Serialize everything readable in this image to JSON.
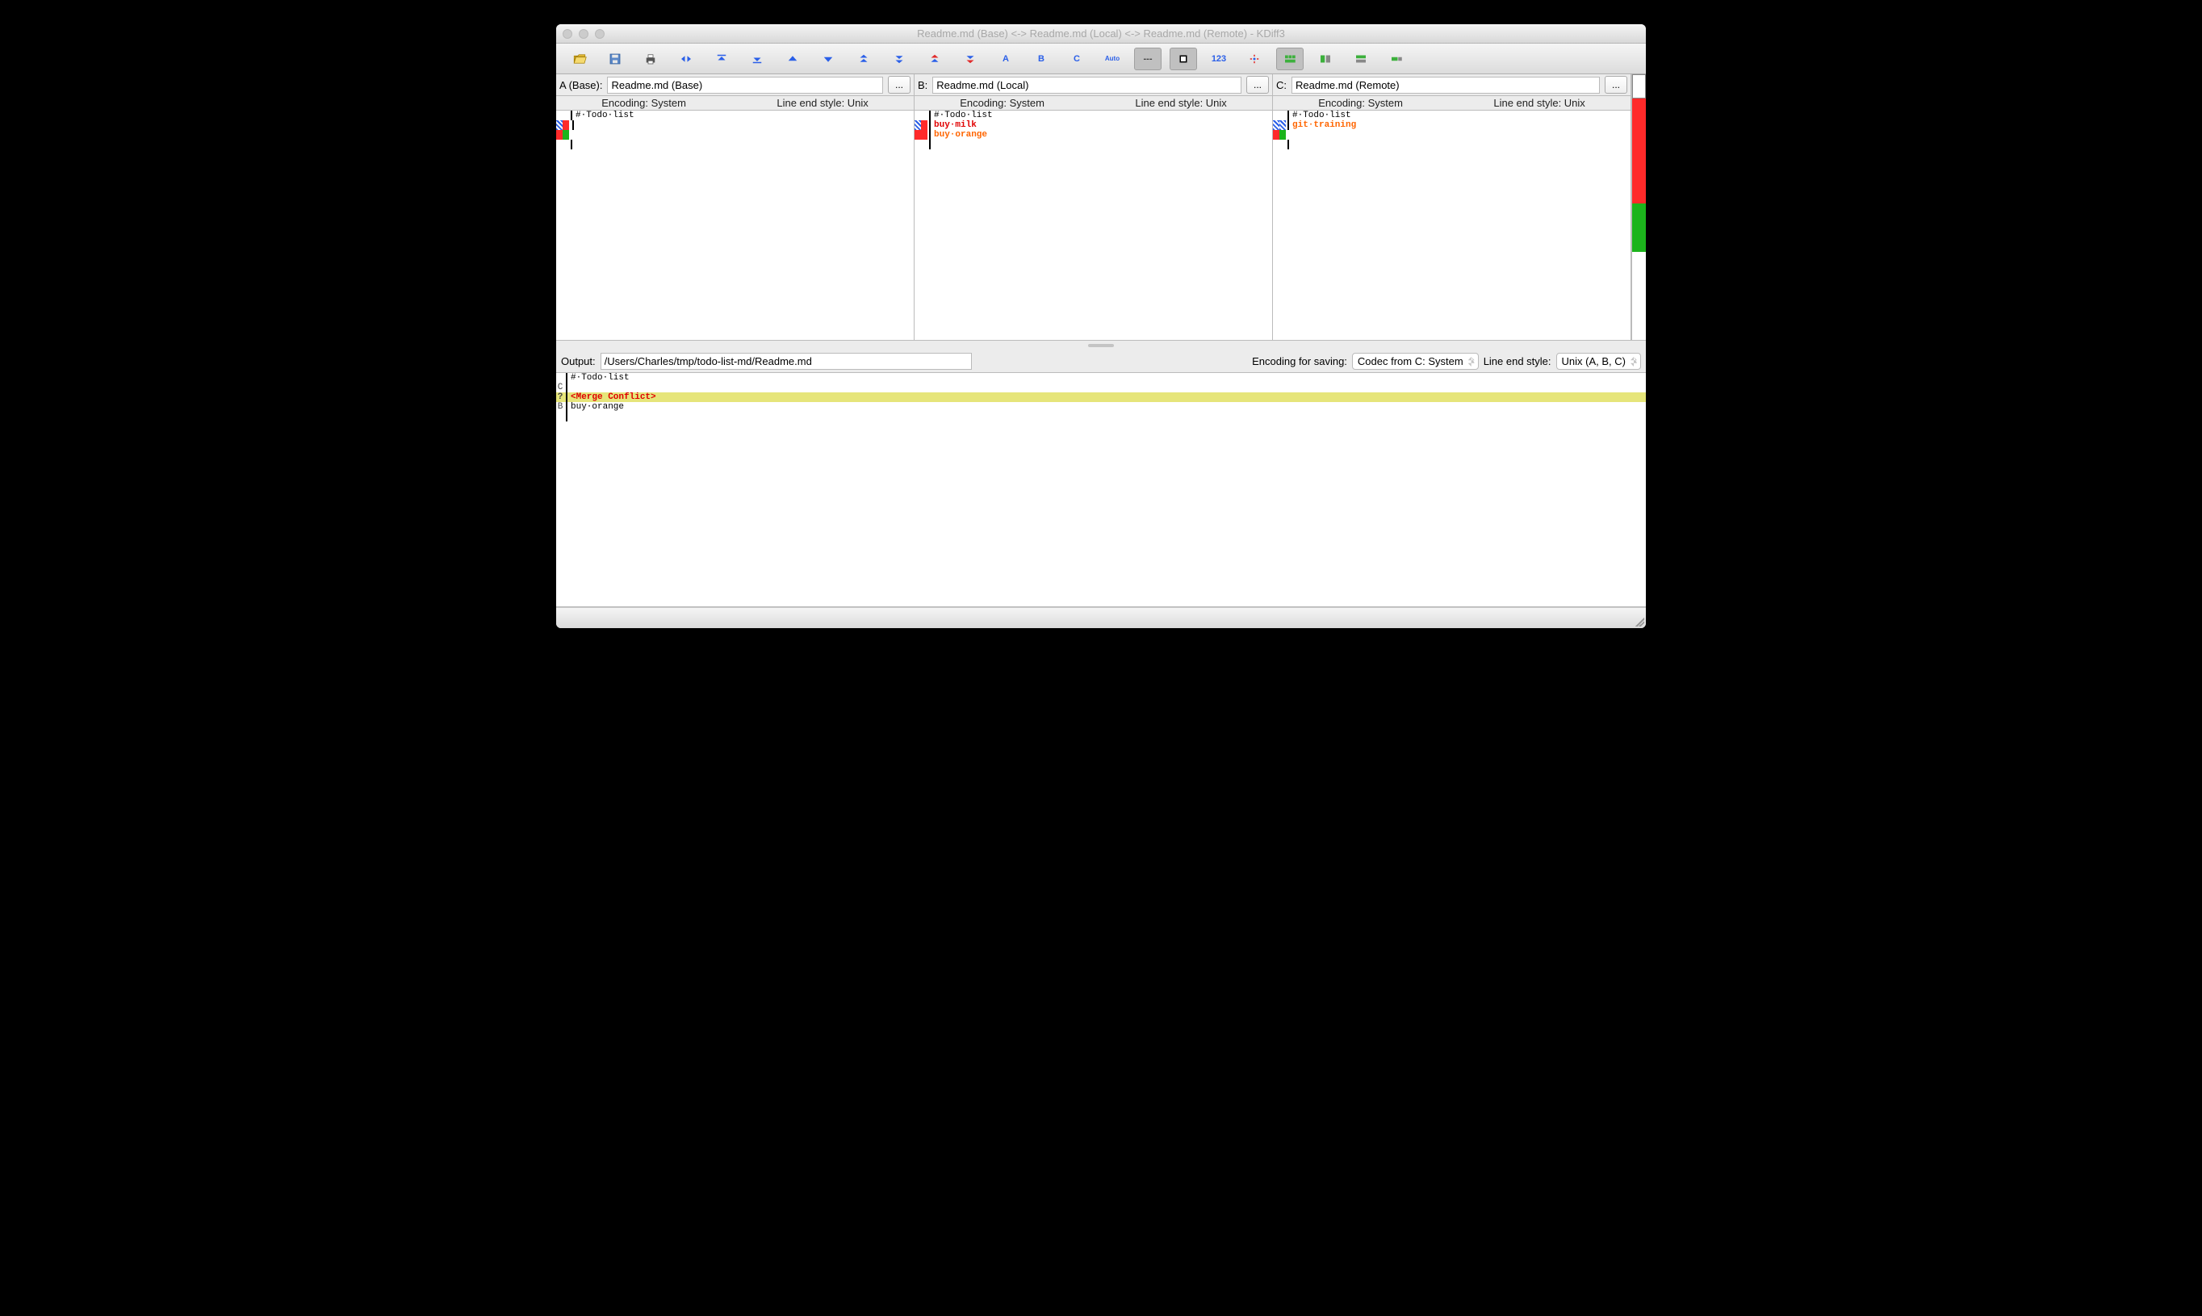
{
  "window": {
    "title": "Readme.md (Base) <-> Readme.md (Local) <-> Readme.md (Remote) - KDiff3"
  },
  "toolbar": {
    "btn_a": "A",
    "btn_b": "B",
    "btn_c": "C",
    "btn_auto": "Auto",
    "btn_dashes": "---",
    "btn_123": "123"
  },
  "panes": {
    "a": {
      "label": "A (Base):",
      "file": "Readme.md (Base)",
      "dots": "...",
      "encoding": "Encoding: System",
      "eol": "Line end style: Unix",
      "lines": [
        "#·Todo·list"
      ]
    },
    "b": {
      "label": "B:",
      "file": "Readme.md (Local)",
      "dots": "...",
      "encoding": "Encoding: System",
      "eol": "Line end style: Unix",
      "lines": [
        "#·Todo·list",
        "buy·milk",
        "buy·orange"
      ]
    },
    "c": {
      "label": "C:",
      "file": "Readme.md (Remote)",
      "dots": "...",
      "encoding": "Encoding: System",
      "eol": "Line end style: Unix",
      "lines": [
        "#·Todo·list",
        "git·training"
      ]
    }
  },
  "output": {
    "label": "Output:",
    "path": "/Users/Charles/tmp/todo-list-md/Readme.md",
    "enc_label": "Encoding for saving:",
    "enc_value": "Codec from C: System",
    "eol_label": "Line end style:",
    "eol_value": "Unix (A, B, C)"
  },
  "merge": {
    "l1_src": " ",
    "l1_txt": "#·Todo·list",
    "l2_src": "C",
    "l2_txt": "",
    "l3_src": "?",
    "l3_txt": "<Merge Conflict>",
    "l4_src": "B",
    "l4_txt": "buy·orange",
    "l5_src": " ",
    "l5_txt": ""
  }
}
